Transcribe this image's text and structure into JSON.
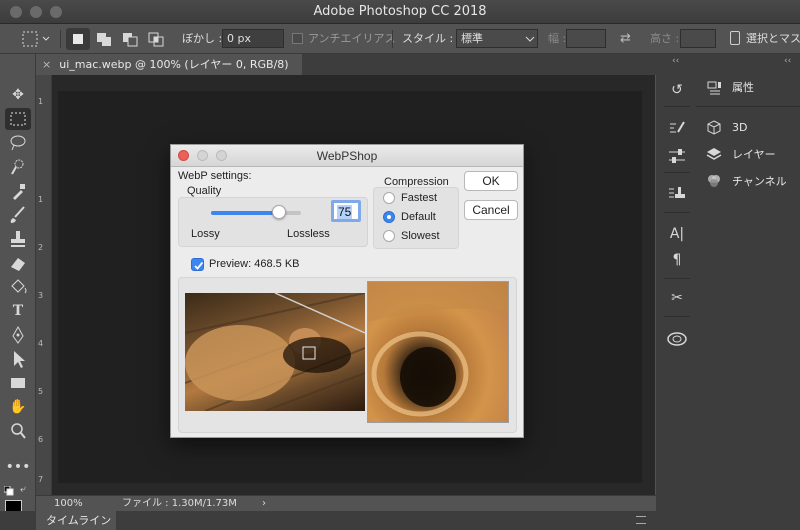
{
  "app": {
    "title": "Adobe Photoshop CC 2018"
  },
  "options_bar": {
    "feather_label": "ぼかし :",
    "feather_value": "0 px",
    "antialias_label": "アンチエイリアス",
    "style_label": "スタイル :",
    "style_value": "標準",
    "width_label": "幅 :",
    "height_label": "高さ :",
    "select_mask_label": "選択とマス"
  },
  "document": {
    "tab_title": "ui_mac.webp @ 100% (レイヤー 0, RGB/8)"
  },
  "status": {
    "zoom": "100%",
    "file_info": "ファイル : 1.30M/1.73M",
    "arrow": "›"
  },
  "bottom": {
    "timeline_label": "タイムライン"
  },
  "ruler": {
    "numbers": [
      "1",
      "1",
      "2",
      "3",
      "4",
      "5",
      "6",
      "7"
    ]
  },
  "panels": {
    "properties": "属性",
    "threed": "3D",
    "layers": "レイヤー",
    "channels": "チャンネル"
  },
  "dialog": {
    "title": "WebPShop",
    "settings_label": "WebP settings:",
    "quality_label": "Quality",
    "quality_value": "75",
    "quality_level": 0.75,
    "lossy_label": "Lossy",
    "lossless_label": "Lossless",
    "compression_label": "Compression",
    "compression_options": [
      "Fastest",
      "Default",
      "Slowest"
    ],
    "compression_selected": "Default",
    "ok_label": "OK",
    "cancel_label": "Cancel",
    "preview_label": "Preview: 468.5 KB",
    "preview_checked": true
  },
  "colors": {
    "accent": "#3d86f0",
    "panel_bg": "#535353",
    "dialog_bg": "#ececec"
  }
}
